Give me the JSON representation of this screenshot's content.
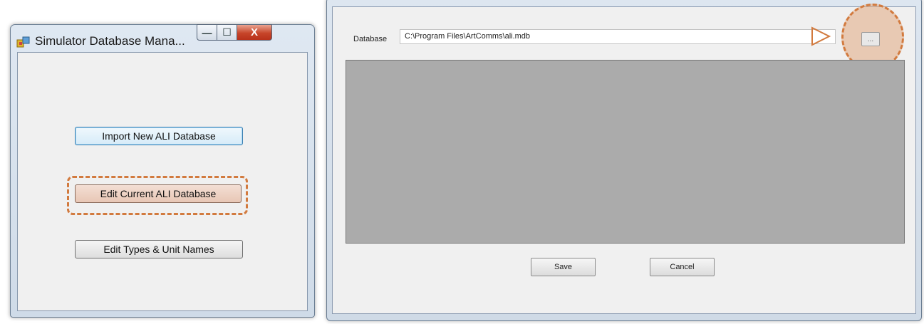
{
  "left_window": {
    "title": "Simulator Database Mana...",
    "controls": {
      "minimize": "—",
      "maximize": "☐",
      "close": "X"
    },
    "buttons": {
      "import": "Import New ALI Database",
      "edit_current": "Edit Current ALI Database",
      "edit_types": "Edit Types & Unit Names"
    }
  },
  "right_window": {
    "database_label": "Database",
    "database_path": "C:\\Program Files\\ArtComms\\ali.mdb",
    "browse_label": "...",
    "save_label": "Save",
    "cancel_label": "Cancel"
  },
  "colors": {
    "highlight": "#d27a3e",
    "grid": "#ababab"
  }
}
